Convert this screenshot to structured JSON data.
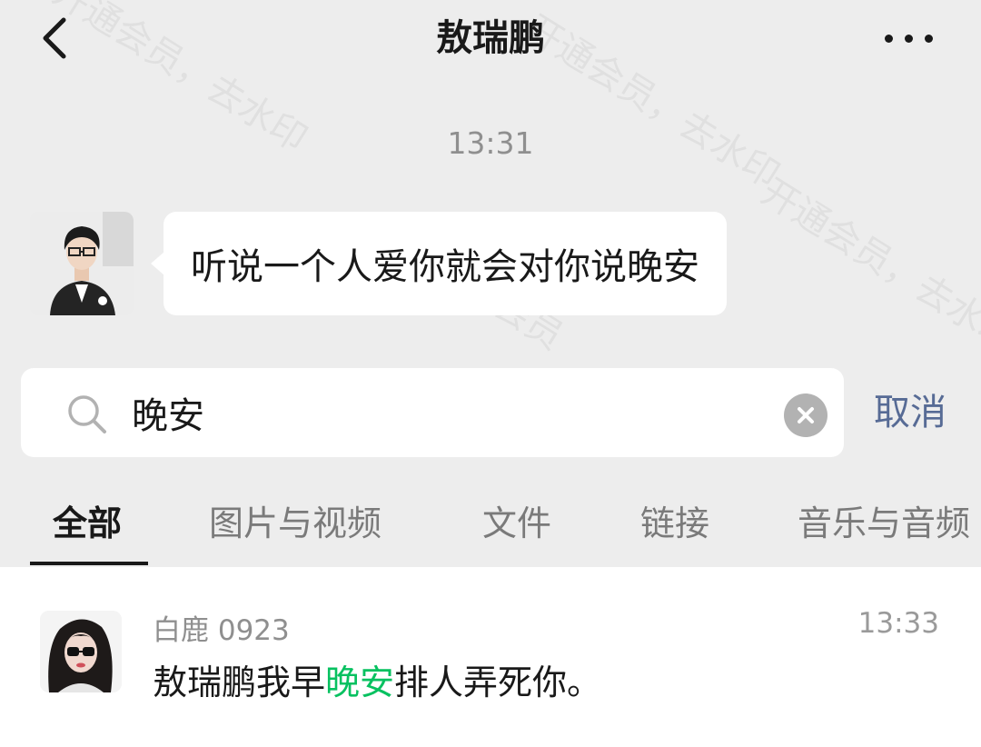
{
  "nav": {
    "title": "敖瑞鹏"
  },
  "chat": {
    "timestamp": "13:31",
    "message": "听说一个人爱你就会对你说晚安"
  },
  "search": {
    "value": "晚安",
    "cancel_label": "取消"
  },
  "tabs": [
    {
      "label": "全部",
      "active": true
    },
    {
      "label": "图片与视频"
    },
    {
      "label": "文件"
    },
    {
      "label": "链接"
    },
    {
      "label": "音乐与音频"
    }
  ],
  "results": [
    {
      "sender": "白鹿 0923",
      "time": "13:33",
      "text_before": "敖瑞鹏我早",
      "highlight": "晚安",
      "text_after": "排人弄死你。"
    }
  ],
  "watermark": [
    "开通会员，去水印",
    "开通会员，去水印",
    "开通会员，去水印",
    "开通会员"
  ],
  "colors": {
    "background": "#ededed",
    "link": "#576b95",
    "highlight": "#07c160"
  },
  "icons": [
    "back-arrow-icon",
    "more-dots-icon",
    "search-icon",
    "clear-icon"
  ]
}
